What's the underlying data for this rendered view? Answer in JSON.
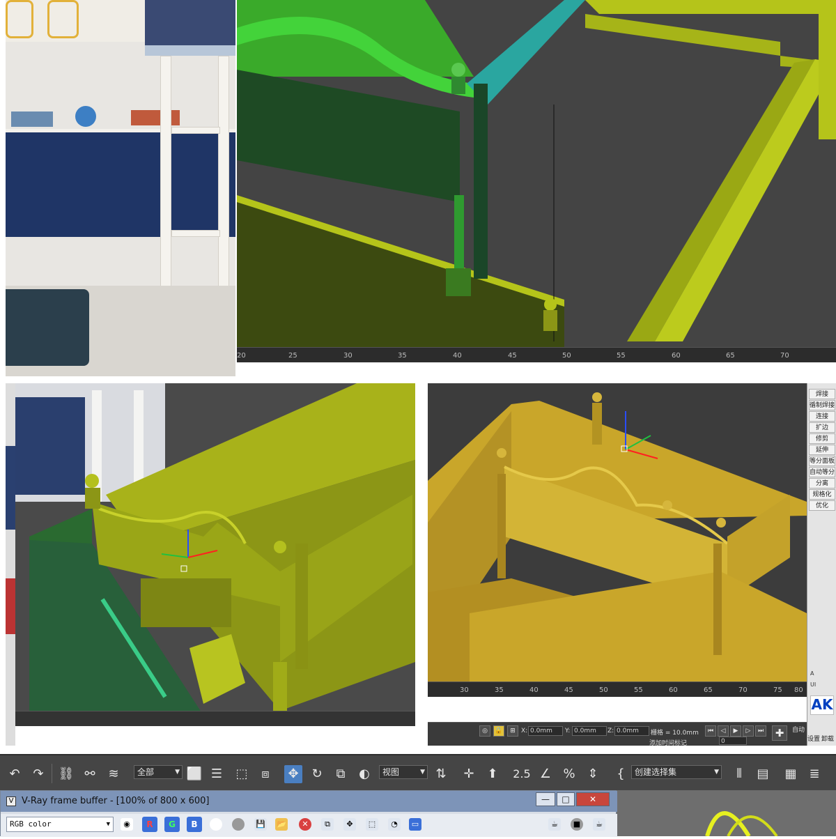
{
  "top_timeline": {
    "ticks": [
      "20",
      "25",
      "30",
      "35",
      "40",
      "45",
      "50",
      "55",
      "60",
      "65",
      "70"
    ]
  },
  "bottom_right_timeline": {
    "ticks": [
      "30",
      "35",
      "40",
      "45",
      "50",
      "55",
      "60",
      "65",
      "70",
      "75",
      "80"
    ]
  },
  "command_panel": {
    "items": [
      "焊接",
      "循制焊接",
      "连接",
      "扩边",
      "修剪",
      "延伸",
      "等分面板",
      "自动等分",
      "分离",
      "规格化",
      "优化"
    ],
    "bottom_labels": {
      "a": "A",
      "ui": "UI",
      "settings": "设置",
      "uninstall": "卸载",
      "auto": "自动"
    }
  },
  "status_bar": {
    "x_label": "X:",
    "x_value": "0.0mm",
    "y_label": "Y:",
    "y_value": "0.0mm",
    "z_label": "Z:",
    "z_value": "0.0mm",
    "grid_label": "栅格 = 10.0mm",
    "add_time_tag": "添加时间标记",
    "frame_value": "0"
  },
  "toolbar": {
    "filter_dropdown": "全部",
    "view_dropdown": "视图",
    "selection_set_dropdown": "创建选择集",
    "snap_25": "2.5"
  },
  "vray_frame_buffer": {
    "title": "V-Ray frame buffer - [100% of 800 x 600]",
    "channel_select": "RGB color",
    "r_label": "R",
    "g_label": "G",
    "b_label": "B"
  },
  "colors": {
    "viewport_bg": "#454545",
    "toolbar_bg": "#454545",
    "active_tool": "#4a7fc1",
    "model_yellow_green": "#b5c41a",
    "model_olive": "#8c9616",
    "model_gold": "#c9a62a",
    "vfb_title": "#7d94b8"
  }
}
